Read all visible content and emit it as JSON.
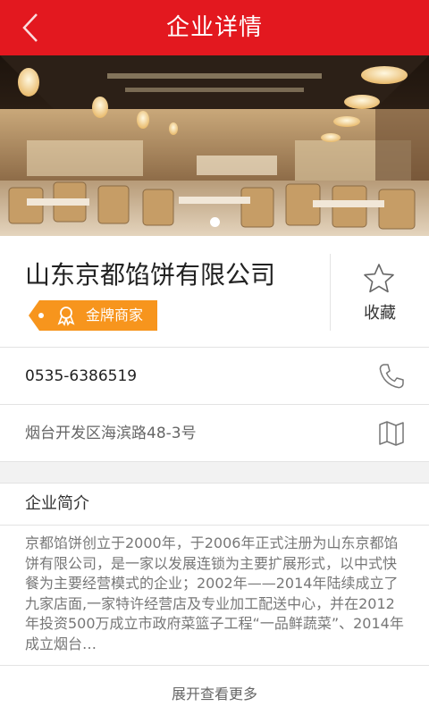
{
  "header": {
    "title": "企业详情",
    "back_icon": "chevron-left-icon",
    "background_color": "#e3181f"
  },
  "banner": {
    "image_desc_icon": "restaurant-interior-photo",
    "slide_count": 1,
    "active_slide": 1
  },
  "company": {
    "name": "山东京都馅饼有限公司",
    "badge_label": "金牌商家",
    "badge_color": "#f7951d",
    "favorite_label": "收藏",
    "favorite_icon": "star-outline-icon"
  },
  "contact": {
    "phone": "0535-6386519",
    "phone_icon": "phone-icon",
    "address": "烟台开发区海滨路48-3号",
    "map_icon": "map-icon"
  },
  "intro": {
    "title": "企业简介",
    "body": "京都馅饼创立于2000年，于2006年正式注册为山东京都馅饼有限公司，是一家以发展连锁为主要扩展形式，以中式快餐为主要经营模式的企业；2002年——2014年陆续成立了九家店面,一家特许经营店及专业加工配送中心，并在2012年投资500万成立市政府菜篮子工程“一品鲜蔬菜”、2014年成立烟台…",
    "more_label": "展开查看更多"
  }
}
